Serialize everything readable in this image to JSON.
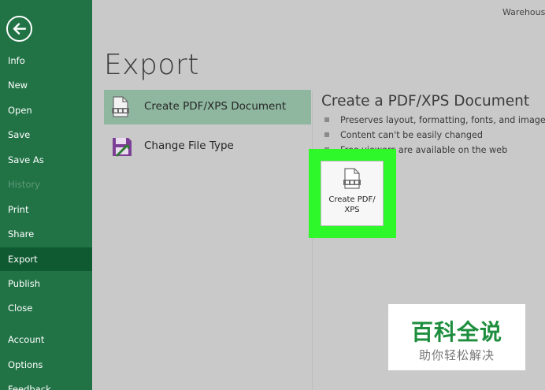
{
  "window": {
    "title": "Warehouse"
  },
  "sidebar": {
    "items": [
      {
        "label": "Info",
        "state": "normal"
      },
      {
        "label": "New",
        "state": "normal"
      },
      {
        "label": "Open",
        "state": "normal"
      },
      {
        "label": "Save",
        "state": "normal"
      },
      {
        "label": "Save As",
        "state": "normal"
      },
      {
        "label": "History",
        "state": "disabled"
      },
      {
        "label": "Print",
        "state": "normal"
      },
      {
        "label": "Share",
        "state": "normal"
      },
      {
        "label": "Export",
        "state": "selected"
      },
      {
        "label": "Publish",
        "state": "normal"
      },
      {
        "label": "Close",
        "state": "normal"
      },
      {
        "label": "Account",
        "state": "normal"
      },
      {
        "label": "Options",
        "state": "normal"
      },
      {
        "label": "Feedback",
        "state": "normal"
      }
    ]
  },
  "main": {
    "heading": "Export",
    "options": [
      {
        "label": "Create PDF/XPS Document",
        "icon": "pdf-document-icon",
        "selected": true
      },
      {
        "label": "Change File Type",
        "icon": "save-file-type-icon",
        "selected": false
      }
    ]
  },
  "detail": {
    "title": "Create a PDF/XPS Document",
    "bullets": [
      "Preserves layout, formatting, fonts, and images",
      "Content can't be easily changed",
      "Free viewers are available on the web"
    ],
    "action_button": {
      "line1": "Create PDF/",
      "line2": "XPS",
      "icon": "pdf-document-icon"
    }
  },
  "watermark": {
    "main": "百科全说",
    "sub": "助你轻松解决"
  },
  "colors": {
    "sidebar": "#217346",
    "sidebar_selected": "#0f5a31",
    "option_selected": "#8fb7a0",
    "highlight": "#2ef72a",
    "background": "#c9c9c9"
  }
}
